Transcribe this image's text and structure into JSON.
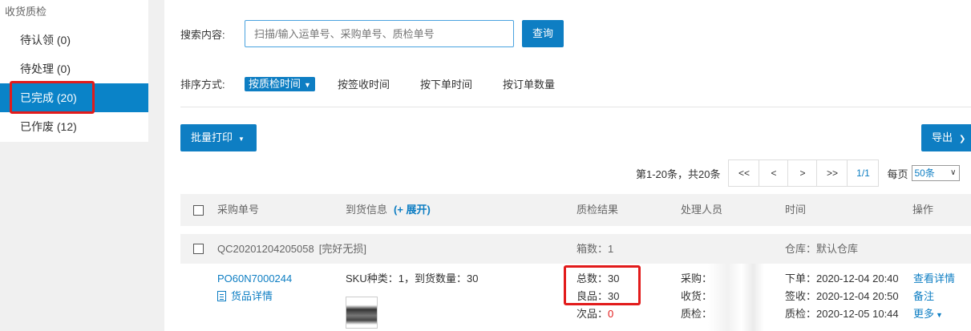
{
  "sidebar": {
    "title": "收货质检",
    "items": [
      {
        "label": "待认领 (0)"
      },
      {
        "label": "待处理 (0)"
      },
      {
        "label": "已完成 (20)"
      },
      {
        "label": "已作废 (12)"
      }
    ]
  },
  "search": {
    "label": "搜索内容:",
    "placeholder": "扫描/输入运单号、采购单号、质检单号",
    "button": "查询"
  },
  "sort": {
    "label": "排序方式:",
    "active": "按质检时间",
    "options": [
      "按签收时间",
      "按下单时间",
      "按订单数量"
    ]
  },
  "toolbar": {
    "batch_print": "批量打印",
    "export": "导出"
  },
  "pager": {
    "info": "第1-20条，共20条",
    "first": "<<",
    "prev": "<",
    "next": ">",
    "last": ">>",
    "current": "1/1",
    "per_page_label": "每页",
    "per_page_value": "50条"
  },
  "table": {
    "headers": {
      "po": "采购单号",
      "arrival": "到货信息",
      "expand": "(+ 展开)",
      "qc_result": "质检结果",
      "handler": "处理人员",
      "time": "时间",
      "action": "操作"
    },
    "group": {
      "qc_no": "QC20201204205058",
      "status": "[完好无损]",
      "boxes": "箱数：1",
      "warehouse": "仓库：默认仓库"
    },
    "row": {
      "po_no": "PO60N7000244",
      "goods_detail": "货品详情",
      "arrival_info": "SKU种类：1，到货数量：30",
      "total_label": "总数：",
      "total_value": "30",
      "good_label": "良品：",
      "good_value": "30",
      "defect_label": "次品：",
      "defect_value": "0",
      "purchase_label": "采购：",
      "receive_label": "收货：",
      "qc_label": "质检：",
      "order_time": "下单：2020-12-04 20:40",
      "sign_time": "签收：2020-12-04 20:50",
      "qc_time": "质检：2020-12-05 10:44",
      "actions": {
        "detail": "查看详情",
        "note": "备注",
        "more": "更多"
      }
    }
  },
  "colors": {
    "accent": "#0e7ec3",
    "highlight": "#e21b1b"
  }
}
